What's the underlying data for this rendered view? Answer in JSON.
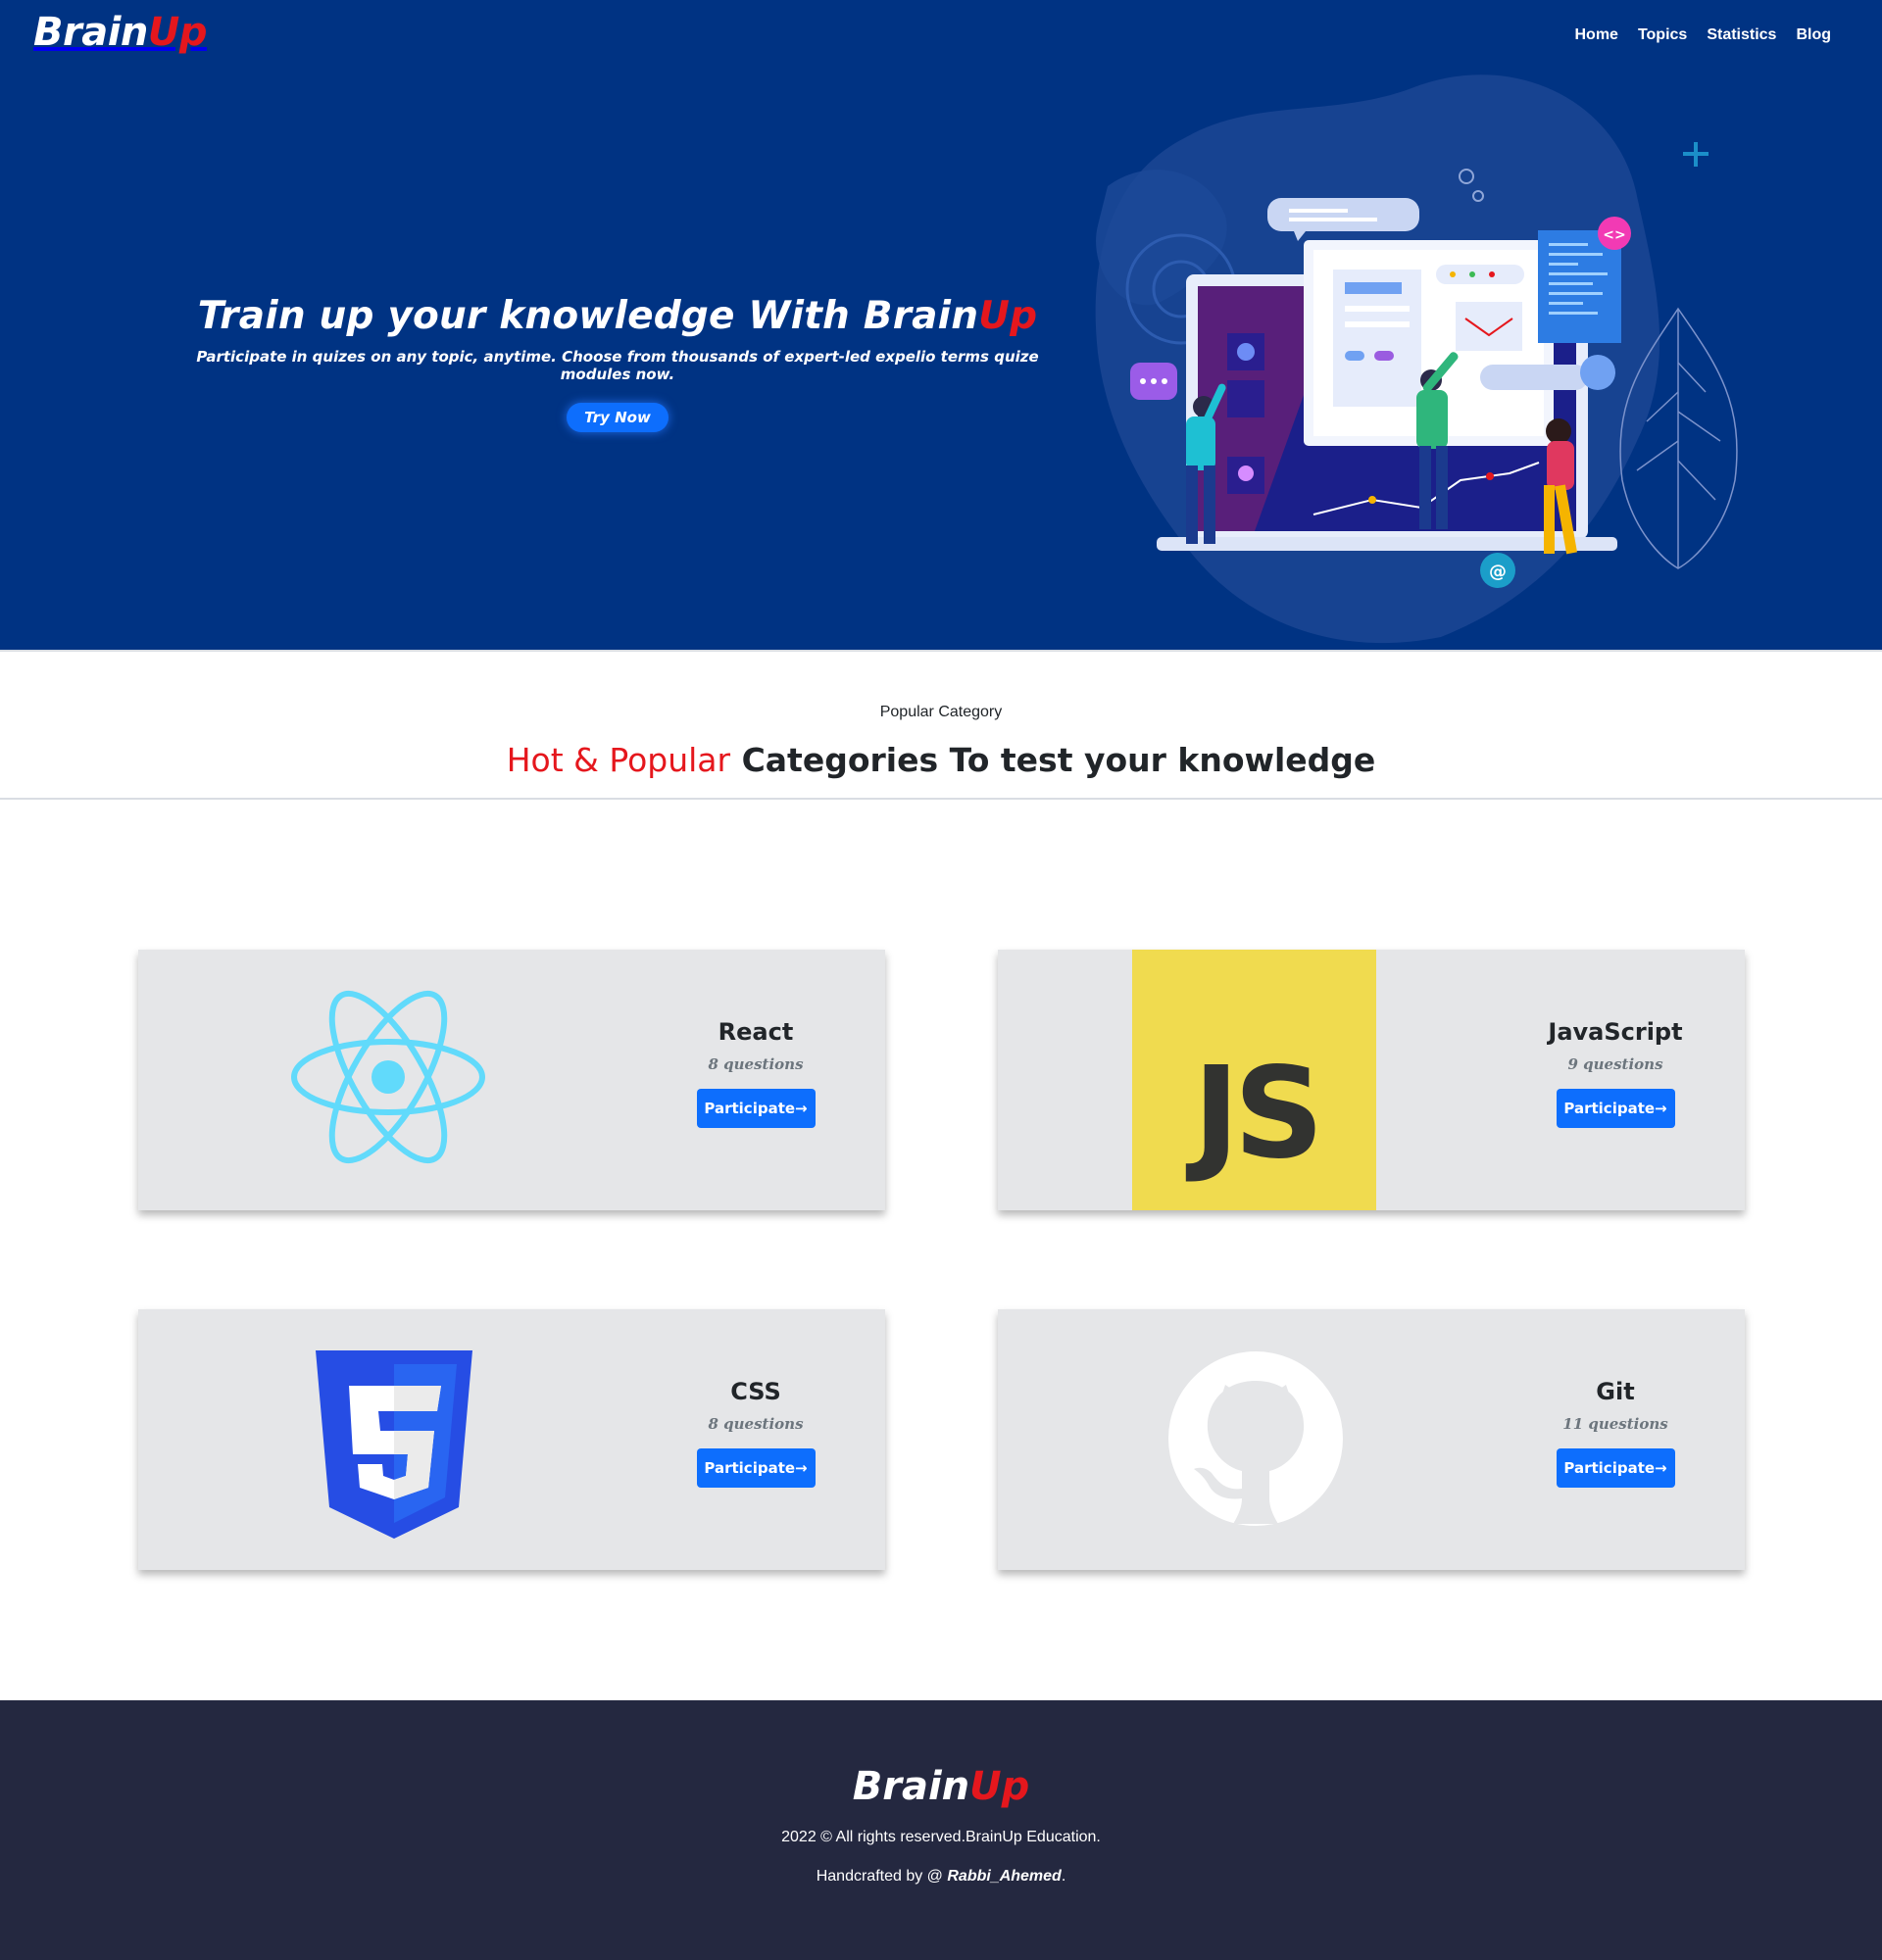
{
  "brand": {
    "part1": "Brain",
    "part2": "Up"
  },
  "nav": {
    "items": [
      {
        "label": "Home"
      },
      {
        "label": "Topics"
      },
      {
        "label": "Statistics"
      },
      {
        "label": "Blog"
      }
    ]
  },
  "hero": {
    "title_main": "Train up your knowledge With Brain",
    "title_accent": "Up",
    "subtitle": "Participate in quizes on any topic, anytime. Choose from thousands of expert-led expelio terms quize modules now.",
    "cta_label": "Try Now"
  },
  "categories_section": {
    "label": "Popular Category",
    "title_accent": "Hot & Popular",
    "title_rest": " Categories To test your knowledge"
  },
  "cards": [
    {
      "name": "React",
      "questions": "8 questions",
      "button": "Participate",
      "icon": "react-logo-icon"
    },
    {
      "name": "JavaScript",
      "questions": "9 questions",
      "button": "Participate",
      "icon": "javascript-logo-icon",
      "logo_text": "JS"
    },
    {
      "name": "CSS",
      "questions": "8 questions",
      "button": "Participate",
      "icon": "css3-logo-icon"
    },
    {
      "name": "Git",
      "questions": "11 questions",
      "button": "Participate",
      "icon": "github-logo-icon"
    }
  ],
  "footer": {
    "copyright": "2022 © All rights reserved.BrainUp Education.",
    "handcrafted_prefix": "Handcrafted by @ ",
    "author": "Rabbi_Ahemed",
    "suffix": "."
  },
  "colors": {
    "hero_bg": "#003383",
    "accent_red": "#e5171d",
    "button_blue": "#0d6efd",
    "card_bg": "#e5e6e8",
    "footer_bg": "#242840",
    "js_yellow": "#f0db4f",
    "react_cyan": "#61dafb",
    "css_blue": "#264de4"
  }
}
